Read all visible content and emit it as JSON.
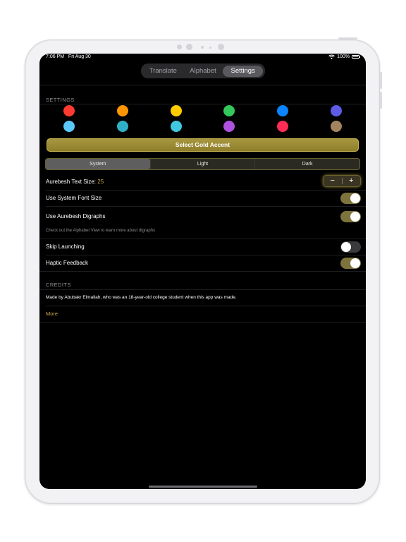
{
  "status": {
    "time": "7:06 PM",
    "date": "Fri Aug 30",
    "battery": "100%"
  },
  "tabs": [
    {
      "label": "Translate",
      "active": false
    },
    {
      "label": "Alphabet",
      "active": false
    },
    {
      "label": "Settings",
      "active": true
    }
  ],
  "settings": {
    "header": "SETTINGS",
    "accent_colors": [
      "#ff3b30",
      "#ff9500",
      "#ffcc00",
      "#34c759",
      "#0a84ff",
      "#5e5ce6",
      "#5ac8fa",
      "#30b0c7",
      "#40c8e0",
      "#af52de",
      "#ff2d55",
      "#a2845e"
    ],
    "gold_button": "Select Gold Accent",
    "theme_options": [
      {
        "label": "System",
        "active": true
      },
      {
        "label": "Light",
        "active": false
      },
      {
        "label": "Dark",
        "active": false
      }
    ],
    "text_size_label": "Aurebesh Text Size:",
    "text_size_value": "25",
    "stepper_minus": "−",
    "stepper_plus": "+",
    "system_font_label": "Use System Font Size",
    "system_font_on": true,
    "digraphs_label": "Use Aurebesh Digraphs",
    "digraphs_on": true,
    "digraphs_footer": "Check out the Alphabet View to learn more about digraphs",
    "skip_label": "Skip Launching",
    "skip_on": false,
    "haptic_label": "Haptic Feedback",
    "haptic_on": true
  },
  "credits": {
    "header": "CREDITS",
    "text": "Made by Abubakr Elmallah, who was an 18-year-old college student when this app was made.",
    "more": "More"
  },
  "colors": {
    "accent_gold": "#c8aa4a",
    "toggle_on": "#7d733c"
  }
}
